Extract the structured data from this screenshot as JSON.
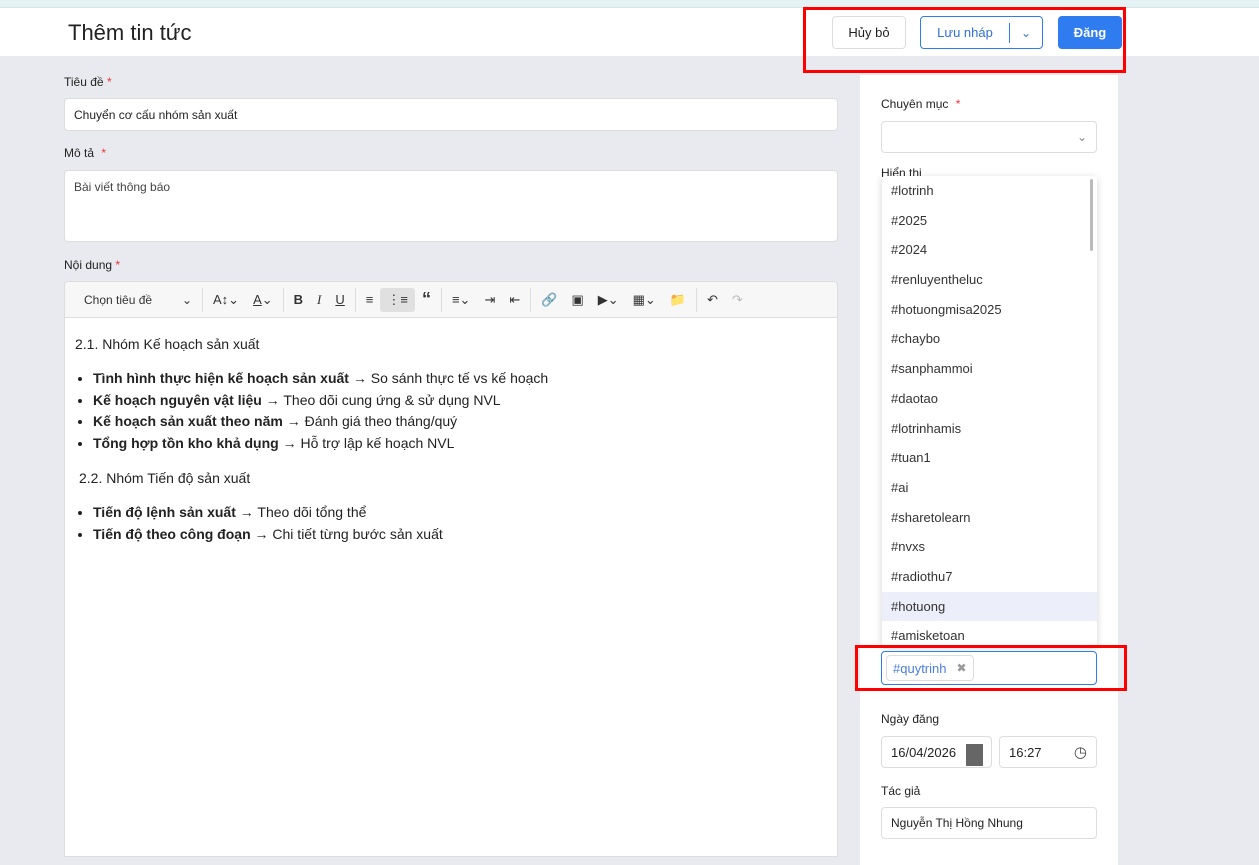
{
  "header": {
    "title": "Thêm tin tức",
    "cancel": "Hủy bỏ",
    "draft": "Lưu nháp",
    "post": "Đăng"
  },
  "form": {
    "title_label": "Tiêu đề",
    "title_value": "Chuyển cơ cấu nhóm sản xuất",
    "desc_label": "Mô tả",
    "desc_value": "Bài viết thông báo",
    "content_label": "Nội dung",
    "required": "*"
  },
  "toolbar": {
    "heading": "Chọn tiêu đề"
  },
  "content": {
    "h1": "2.1. Nhóm Kế hoạch sản xuất",
    "list1": [
      {
        "b": "Tình hình thực hiện kế hoạch sản xuất",
        "t": " → So sánh thực tế vs kế hoạch"
      },
      {
        "b": "Kế hoạch nguyên vật liệu",
        "t": " → Theo dõi cung ứng & sử dụng NVL"
      },
      {
        "b": "Kế hoạch sản xuất theo năm",
        "t": " → Đánh giá theo tháng/quý"
      },
      {
        "b": "Tổng hợp tồn kho khả dụng",
        "t": " → Hỗ trợ lập kế hoạch NVL"
      }
    ],
    "h2": "2.2. Nhóm Tiến độ sản xuất",
    "list2": [
      {
        "b": "Tiến độ lệnh sản xuất",
        "t": " → Theo dõi tổng thể"
      },
      {
        "b": "Tiến độ theo công đoạn",
        "t": " → Chi tiết từng bước sản xuất"
      }
    ]
  },
  "sidebar": {
    "category_label": "Chuyên mục",
    "display_label": "Hiển thị",
    "tag_options": [
      "#lotrinh",
      "#2025",
      "#2024",
      "#renluyentheluc",
      "#hotuongmisa2025",
      "#chaybo",
      "#sanphammoi",
      "#daotao",
      "#lotrinhamis",
      "#tuan1",
      "#ai",
      "#sharetolearn",
      "#nvxs",
      "#radiothu7",
      "#hotuong",
      "#amisketoan"
    ],
    "highlighted": "#hotuong",
    "selected_tag": "#quytrinh",
    "date_label": "Ngày đăng",
    "date": "16/04/2026",
    "time": "16:27",
    "author_label": "Tác giả",
    "author": "Nguyễn Thị Hồng Nhung"
  }
}
